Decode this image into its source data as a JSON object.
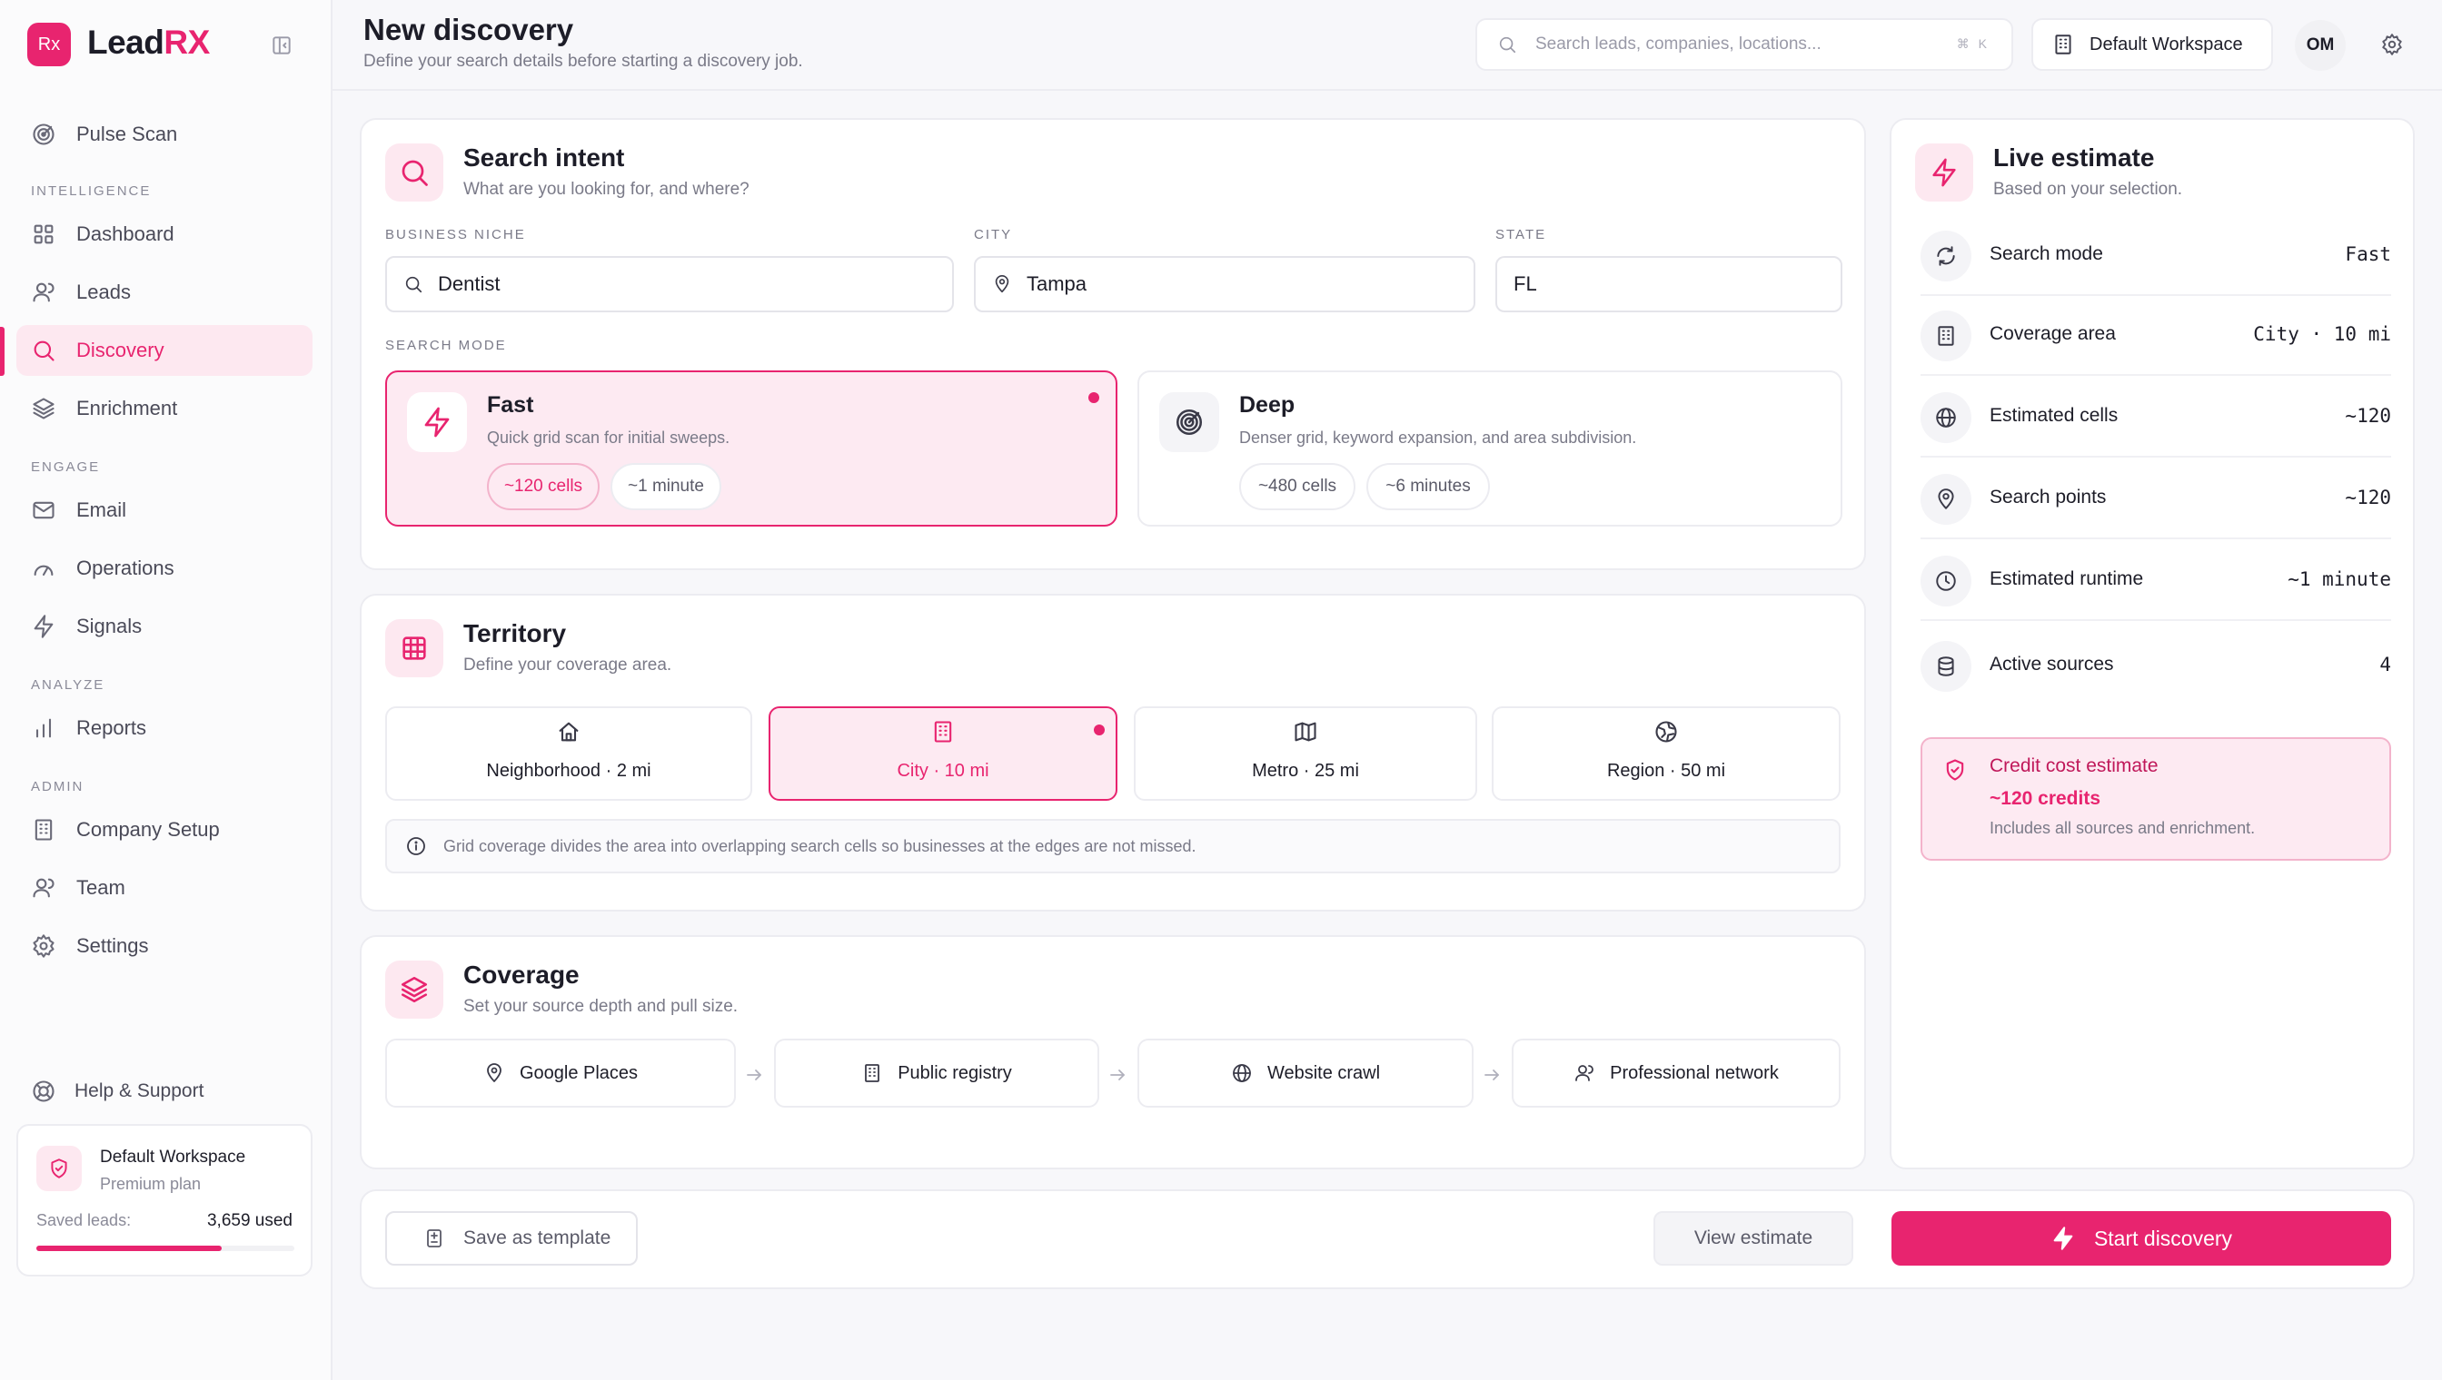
{
  "app": {
    "logo_text": "Rx",
    "brand_main": "Lead",
    "brand_accent": "RX"
  },
  "accent_color": "#e8246f",
  "sidebar": {
    "top_item": "Pulse Scan",
    "sections": {
      "intelligence": "INTELLIGENCE",
      "engage": "ENGAGE",
      "analyze": "ANALYZE",
      "admin": "ADMIN"
    },
    "items": {
      "dashboard": "Dashboard",
      "leads": "Leads",
      "discovery": "Discovery",
      "enrichment": "Enrichment",
      "email": "Email",
      "operations": "Operations",
      "signals": "Signals",
      "reports": "Reports",
      "company_setup": "Company Setup",
      "team": "Team",
      "settings": "Settings"
    },
    "active_item": "Discovery",
    "help": "Help & Support",
    "workspace": {
      "name": "Default Workspace",
      "plan": "Premium plan",
      "saved_label": "Saved leads:",
      "used": "3,659 used",
      "usage_fraction": 0.72
    }
  },
  "header": {
    "title": "New discovery",
    "subtitle": "Define your search details before starting a discovery job.",
    "search_placeholder": "Search leads, companies, locations...",
    "shortcut": "⌘ K",
    "workspace_button": "Default Workspace",
    "avatar_initials": "OM"
  },
  "search_intent": {
    "title": "Search intent",
    "subtitle": "What are you looking for, and where?",
    "niche_label": "BUSINESS NICHE",
    "niche_value": "Dentist",
    "city_label": "CITY",
    "city_value": "Tampa",
    "state_label": "STATE",
    "state_value": "FL",
    "mode_label": "SEARCH MODE",
    "fast": {
      "title": "Fast",
      "desc": "Quick grid scan for initial sweeps.",
      "cells": "~120 cells",
      "time": "~1 minute",
      "selected": true
    },
    "deep": {
      "title": "Deep",
      "desc": "Denser grid, keyword expansion, and area subdivision.",
      "cells": "~480 cells",
      "time": "~6 minutes",
      "selected": false
    }
  },
  "territory": {
    "title": "Territory",
    "subtitle": "Define your coverage area.",
    "options": [
      "Neighborhood · 2 mi",
      "City · 10 mi",
      "Metro · 25 mi",
      "Region · 50 mi"
    ],
    "selected": "City · 10 mi",
    "info": "Grid coverage divides the area into overlapping search cells so businesses at the edges are not missed."
  },
  "coverage": {
    "title": "Coverage",
    "subtitle": "Set your source depth and pull size.",
    "sources": [
      "Google Places",
      "Public registry",
      "Website crawl",
      "Professional network"
    ]
  },
  "estimate": {
    "title": "Live estimate",
    "subtitle": "Based on your selection.",
    "rows": [
      {
        "label": "Search mode",
        "value": "Fast"
      },
      {
        "label": "Coverage area",
        "value": "City · 10 mi"
      },
      {
        "label": "Estimated cells",
        "value": "~120"
      },
      {
        "label": "Search points",
        "value": "~120"
      },
      {
        "label": "Estimated runtime",
        "value": "~1 minute"
      },
      {
        "label": "Active sources",
        "value": "4"
      }
    ],
    "credit": {
      "title": "Credit cost estimate",
      "value": "~120 credits",
      "note": "Includes all sources and enrichment."
    }
  },
  "actions": {
    "save_template": "Save as template",
    "view_estimate": "View estimate",
    "start": "Start discovery"
  }
}
